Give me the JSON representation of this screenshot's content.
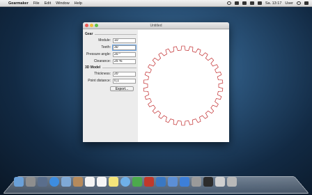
{
  "menubar": {
    "app_name": "Gearmaker",
    "menus": [
      "File",
      "Edit",
      "Window",
      "Help"
    ],
    "clock": "Sa. 13:17",
    "user": "User"
  },
  "window": {
    "title": "Untitled"
  },
  "gear": {
    "section": "Gear",
    "module_label": "Module:",
    "module_value": "10",
    "teeth_label": "Teeth:",
    "teeth_value": "30",
    "pressure_label": "Pressure angle:",
    "pressure_value": "20 °",
    "clearance_label": "Clearance:",
    "clearance_value": "25 %"
  },
  "model": {
    "section": "3D Model",
    "thickness_label": "Thickness:",
    "thickness_value": "20",
    "point_label": "Point distance:",
    "point_value": "0,1",
    "export_label": "Export..."
  },
  "colors": {
    "gear_stroke": "#c0282a"
  },
  "dock": {
    "icons": [
      "finder-icon",
      "launchpad-icon",
      "mission-control-icon",
      "safari-icon",
      "mail-icon",
      "contacts-icon",
      "calendar-icon",
      "reminders-icon",
      "notes-icon",
      "messages-icon",
      "facetime-icon",
      "photo-booth-icon",
      "iphoto-icon",
      "itunes-icon",
      "app-store-icon",
      "system-preferences-icon",
      "gearmaker-icon",
      "downloads-icon",
      "trash-icon"
    ]
  }
}
